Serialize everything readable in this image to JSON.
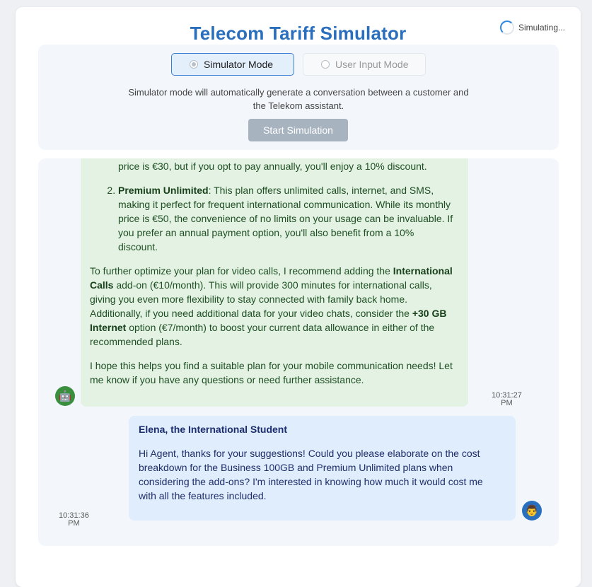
{
  "header": {
    "title": "Telecom Tariff Simulator",
    "status": "Simulating..."
  },
  "modes": {
    "simulator_label": "Simulator Mode",
    "user_label": "User Input Mode",
    "description": "Simulator mode will automatically generate a conversation between a customer and the Telekom assistant.",
    "start_label": "Start Simulation"
  },
  "agent_message": {
    "line_top": "price is €30, but if you opt to pay annually, you'll enjoy a 10% discount.",
    "item2_name": "Premium Unlimited",
    "item2_text": ": This plan offers unlimited calls, internet, and SMS, making it perfect for frequent international communication. While its monthly price is €50, the convenience of no limits on your usage can be invaluable. If you prefer an annual payment option, you'll also benefit from a 10% discount.",
    "para1_a": "To further optimize your plan for video calls, I recommend adding the ",
    "para1_b": "International Calls",
    "para1_c": " add-on (€10/month). This will provide 300 minutes for international calls, giving you even more flexibility to stay connected with family back home. Additionally, if you need additional data for your video chats, consider the ",
    "para1_d": "+30 GB Internet",
    "para1_e": " option (€7/month) to boost your current data allowance in either of the recommended plans.",
    "para2": "I hope this helps you find a suitable plan for your mobile communication needs! Let me know if you have any questions or need further assistance.",
    "time_line1": "10:31:27",
    "time_line2": "PM",
    "avatar_icon": "🤖"
  },
  "user_message": {
    "sender": "Elena, the International Student",
    "text": "Hi Agent, thanks for your suggestions! Could you please elaborate on the cost breakdown for the Business 100GB and Premium Unlimited plans when considering the add-ons? I'm interested in knowing how much it would cost me with all the features included.",
    "time_line1": "10:31:36",
    "time_line2": "PM",
    "avatar_icon": "👨"
  },
  "colors": {
    "title": "#2a6fbe",
    "agent_bubble": "#e3f2e2",
    "user_bubble": "#e0edfc",
    "start_button": "#a7b3bf"
  }
}
